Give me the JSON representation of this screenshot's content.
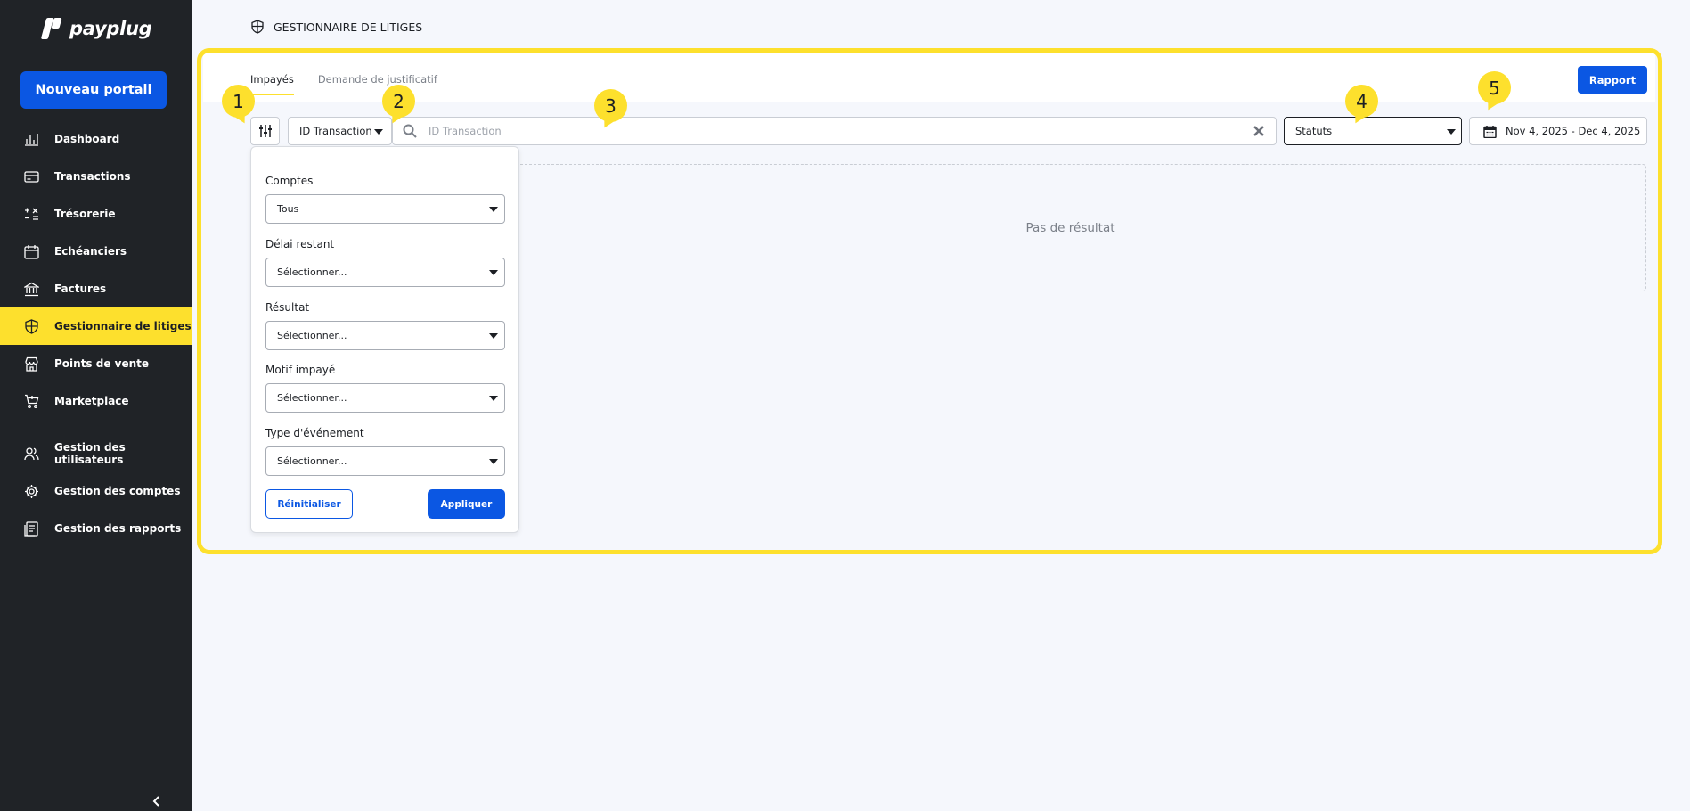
{
  "brand": {
    "name": "payplug"
  },
  "sidebar": {
    "new_portal_label": "Nouveau portail",
    "items": [
      {
        "label": "Dashboard",
        "icon": "chart-bars-icon"
      },
      {
        "label": "Transactions",
        "icon": "card-icon"
      },
      {
        "label": "Trésorerie",
        "icon": "calculator-icon"
      },
      {
        "label": "Echéanciers",
        "icon": "calendar-icon"
      },
      {
        "label": "Factures",
        "icon": "bank-icon"
      },
      {
        "label": "Gestionnaire de litiges",
        "icon": "shield-icon"
      },
      {
        "label": "Points de vente",
        "icon": "store-icon"
      },
      {
        "label": "Marketplace",
        "icon": "cart-icon"
      },
      {
        "label": "Gestion des utilisateurs",
        "icon": "users-icon"
      },
      {
        "label": "Gestion des comptes",
        "icon": "gear-icon"
      },
      {
        "label": "Gestion des rapports",
        "icon": "document-icon"
      }
    ]
  },
  "header": {
    "title": "GESTIONNAIRE DE LITIGES"
  },
  "tabs": [
    {
      "label": "Impayés"
    },
    {
      "label": "Demande de justificatif"
    }
  ],
  "toolbar": {
    "report_label": "Rapport",
    "field_select": "ID Transaction",
    "search_placeholder": "ID Transaction",
    "status_select": "Statuts",
    "date_range": "Nov 4, 2025 - Dec 4, 2025"
  },
  "empty_state": "Pas de résultat",
  "filters": {
    "fields": [
      {
        "label": "Comptes",
        "value": "Tous"
      },
      {
        "label": "Délai restant",
        "value": "Sélectionner..."
      },
      {
        "label": "Résultat",
        "value": "Sélectionner..."
      },
      {
        "label": "Motif impayé",
        "value": "Sélectionner..."
      },
      {
        "label": "Type d'événement",
        "value": "Sélectionner..."
      }
    ],
    "reset_label": "Réinitialiser",
    "apply_label": "Appliquer"
  },
  "callouts": [
    "1",
    "2",
    "3",
    "4",
    "5"
  ],
  "colors": {
    "primary": "#0b57e3",
    "accent": "#fde02d",
    "sidebar": "#202327"
  }
}
